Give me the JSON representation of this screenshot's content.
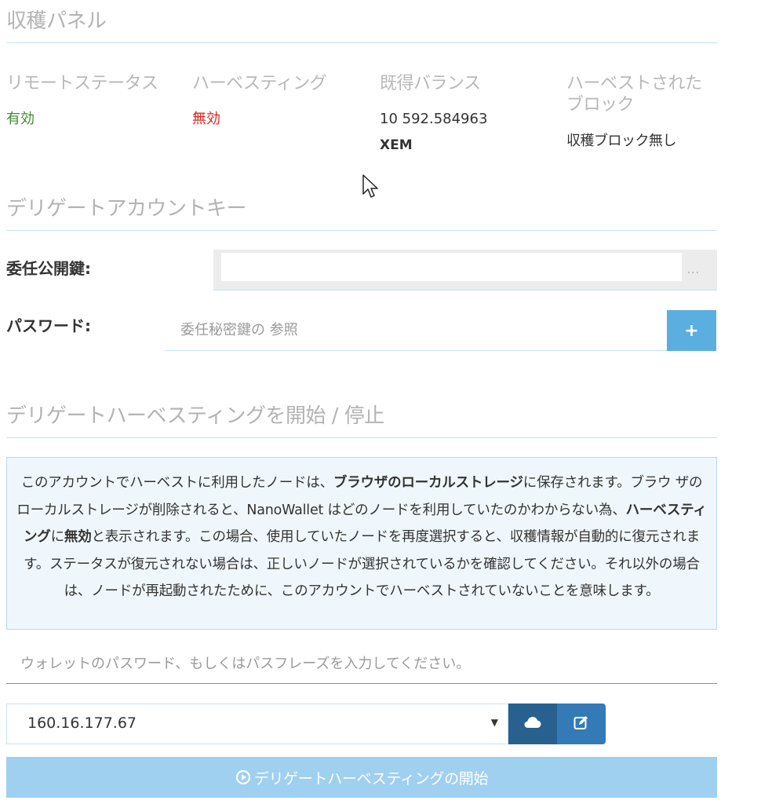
{
  "harvest_panel": {
    "title": "収穫パネル",
    "remote_status": {
      "label": "リモートステータス",
      "value": "有効",
      "color": "#3e8b2e"
    },
    "harvesting": {
      "label": "ハーベスティング",
      "value": "無効",
      "color": "#d9251d"
    },
    "vested_balance": {
      "label": "既得バランス",
      "value": "10 592.584963",
      "unit": "XEM"
    },
    "harvested_blocks": {
      "label_line1": "ハーベストされた",
      "label_line2": "ブロック",
      "value": "収穫ブロック無し"
    }
  },
  "delegated_key": {
    "title": "デリゲートアカウントキー",
    "public_key_label": "委任公開鍵:",
    "public_key_value": "",
    "password_label": "パスワード:",
    "password_placeholder": "委任秘密鍵の 参照",
    "add_button_label": "+"
  },
  "start_stop": {
    "title": "デリゲートハーベスティングを開始 / 停止",
    "info": {
      "p1": "このアカウントでハーベストに利用したノードは、",
      "b1": "ブラウザのローカルストレージ",
      "p2": "に保存されます。ブラウ ザのローカルストレージが削除されると、NanoWallet はどのノードを利用していたのかわからない為、",
      "b2": "ハーベスティング",
      "p3": "に",
      "b3": "無効",
      "p4": "と表示されます。この場合、使用していたノードを再度選択すると、収穫情報が自動的に復元されます。ステータスが復元されない場合は、正しいノードが選択されているかを確認してください。それ以外の場合は、ノードが再起動されたために、このアカウントでハーベストされていないことを意味します。"
    },
    "wallet_password_placeholder": "ウォレットのパスワード、もしくはパスフレーズを入力してください。",
    "node": {
      "selected": "160.16.177.67"
    },
    "start_button_label": "デリゲートハーベスティングの開始"
  },
  "colors": {
    "accent": "#5aaee0",
    "dark_button": "#286090",
    "edit_button": "#337ab7",
    "start_button": "#9fd0f0",
    "info_bg": "#f0f7fc",
    "error_underline": "#d2725f"
  },
  "icons": [
    "plus-icon",
    "cloud-icon",
    "edit-icon",
    "play-circle-icon",
    "mouse-cursor-icon"
  ]
}
